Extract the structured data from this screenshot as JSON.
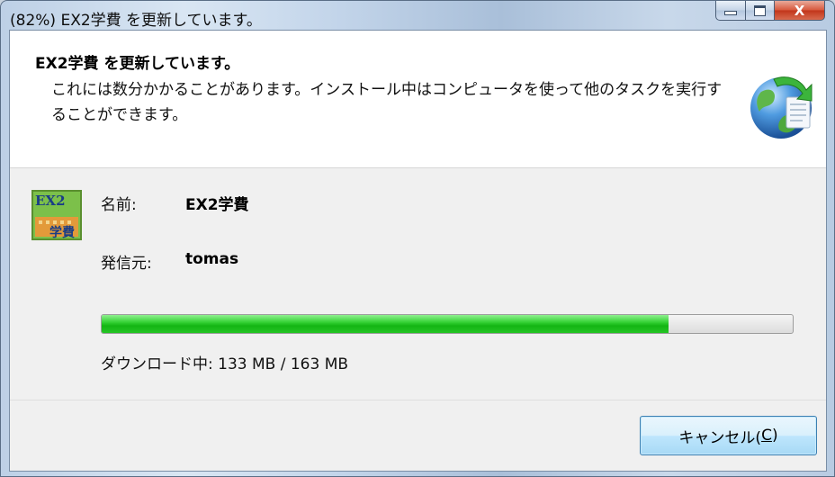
{
  "window": {
    "title": "(82%) EX2学費 を更新しています。",
    "close_glyph": "X"
  },
  "header": {
    "title": "EX2学費 を更新しています。",
    "description": "これには数分かかることがあります。インストール中はコンピュータを使って他のタスクを実行することができます。"
  },
  "app": {
    "icon_text_top": "EX2",
    "icon_text_bottom": "学費",
    "name_label": "名前:",
    "name_value": "EX2学費",
    "publisher_label": "発信元:",
    "publisher_value": "tomas"
  },
  "progress": {
    "fraction": 0.82,
    "status_text": "ダウンロード中: 133 MB / 163 MB",
    "fill_color": "#21c021"
  },
  "footer": {
    "cancel_label_prefix": "キャンセル(",
    "cancel_accesskey": "C",
    "cancel_label_suffix": ")"
  }
}
